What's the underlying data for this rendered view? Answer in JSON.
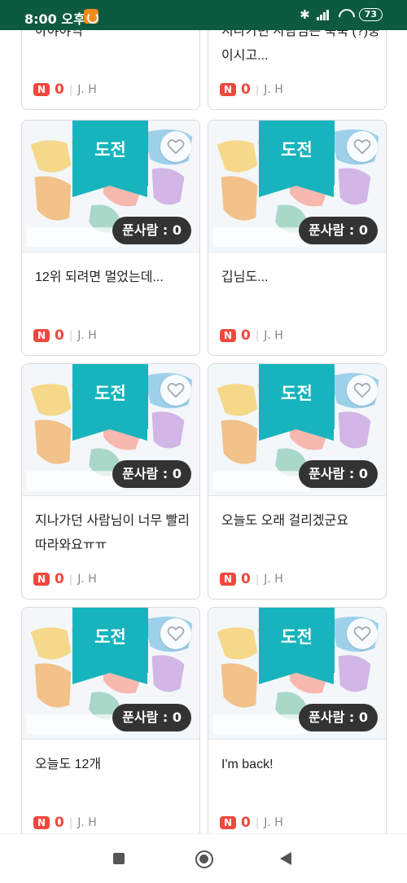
{
  "status_bar": {
    "time": "8:00 오후",
    "battery": "73"
  },
  "cards": [
    {
      "title": "아야야익",
      "badge": "N",
      "comments": "0",
      "author": "J. H",
      "ribbon": "",
      "solvers": ""
    },
    {
      "title": "지나가던 사람님은 북쭉 (?)중 이시고...",
      "badge": "N",
      "comments": "0",
      "author": "J. H",
      "ribbon": "",
      "solvers": ""
    },
    {
      "title": "12위 되려면 멀었는데...",
      "badge": "N",
      "comments": "0",
      "author": "J. H",
      "ribbon": "도전",
      "solvers": "푼사람 : 0"
    },
    {
      "title": "깁님도...",
      "badge": "N",
      "comments": "0",
      "author": "J. H",
      "ribbon": "도전",
      "solvers": "푼사람 : 0"
    },
    {
      "title": "지나가던 사람님이 너무 빨리 따라와요ㅠㅠ",
      "badge": "N",
      "comments": "0",
      "author": "J. H",
      "ribbon": "도전",
      "solvers": "푼사람 : 0"
    },
    {
      "title": "오늘도 오래 걸리겠군요",
      "badge": "N",
      "comments": "0",
      "author": "J. H",
      "ribbon": "도전",
      "solvers": "푼사람 : 0"
    },
    {
      "title": "오늘도 12개",
      "badge": "N",
      "comments": "0",
      "author": "J. H",
      "ribbon": "도전",
      "solvers": "푼사람 : 0"
    },
    {
      "title": "I'm back!",
      "badge": "N",
      "comments": "0",
      "author": "J. H",
      "ribbon": "도전",
      "solvers": "푼사람 : 0"
    }
  ],
  "colors": {
    "status_bar": "#0c5a40",
    "ribbon": "#17b4bd",
    "accent_red": "#f0483e",
    "badge_dark": "#333333"
  },
  "icons": {
    "heart": "heart-outline-icon",
    "nav_recent": "square-icon",
    "nav_home": "circle-icon",
    "nav_back": "triangle-back-icon"
  }
}
